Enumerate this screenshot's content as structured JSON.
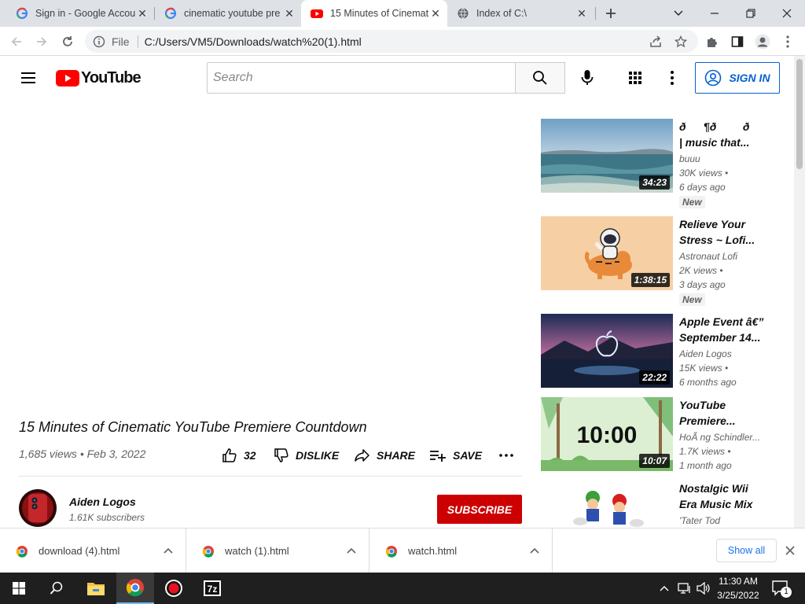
{
  "browser": {
    "tabs": [
      {
        "title": "Sign in - Google Accou",
        "icon": "google-g-icon",
        "active": false
      },
      {
        "title": "cinematic youtube pre",
        "icon": "google-g-icon",
        "active": false
      },
      {
        "title": "15 Minutes of Cinemat",
        "icon": "youtube-icon",
        "active": true
      },
      {
        "title": "Index of C:\\",
        "icon": "globe-icon",
        "active": false
      }
    ],
    "new_tab_icon": "plus-icon",
    "address": {
      "scheme_label": "File",
      "url": "C:/Users/VM5/Downloads/watch%20(1).html"
    }
  },
  "youtube": {
    "logo_text": "YouTube",
    "search_placeholder": "Search",
    "sign_in_label": "SIGN IN",
    "accent_color": "#065fd4",
    "brand_red": "#ff0000"
  },
  "video": {
    "title": "15 Minutes of Cinematic YouTube Premiere Countdown",
    "views": "1,685 views",
    "date": "Feb 3, 2022",
    "separator": "•",
    "likes": "32",
    "dislike_label": "DISLIKE",
    "share_label": "SHARE",
    "save_label": "SAVE",
    "channel": {
      "name": "Aiden Logos",
      "subscribers": "1.61K subscribers"
    },
    "subscribe_label": "SUBSCRIBE"
  },
  "recommendations": [
    {
      "title": "ð¶ððð | music that...",
      "channel": "buuu",
      "views": "30K views",
      "age": "6 days ago",
      "duration": "34:23",
      "badge": "New"
    },
    {
      "title": "Relieve Your Stress ~ Lofi...",
      "channel": "Astronaut Lofi",
      "views": "2K views",
      "age": "3 days ago",
      "duration": "1:38:15",
      "badge": "New"
    },
    {
      "title": "Apple Event â€” September 14...",
      "channel": "Aiden Logos",
      "views": "15K views",
      "age": "6 months ago",
      "duration": "22:22",
      "badge": ""
    },
    {
      "title": "YouTube Premiere...",
      "channel": "HoÃ ng Schindler...",
      "views": "1.7K views",
      "age": "1 month ago",
      "duration": "10:07",
      "badge": "",
      "thumb_text": "10:00"
    },
    {
      "title": "Nostalgic Wii Era Music Mix",
      "channel": "'Tater Tod",
      "views": "",
      "age": "",
      "duration": "",
      "badge": ""
    }
  ],
  "downloads": {
    "items": [
      "download (4).html",
      "watch (1).html",
      "watch.html"
    ],
    "show_all_label": "Show all"
  },
  "taskbar": {
    "time": "11:30 AM",
    "date": "3/25/2022",
    "notification_count": "1"
  }
}
